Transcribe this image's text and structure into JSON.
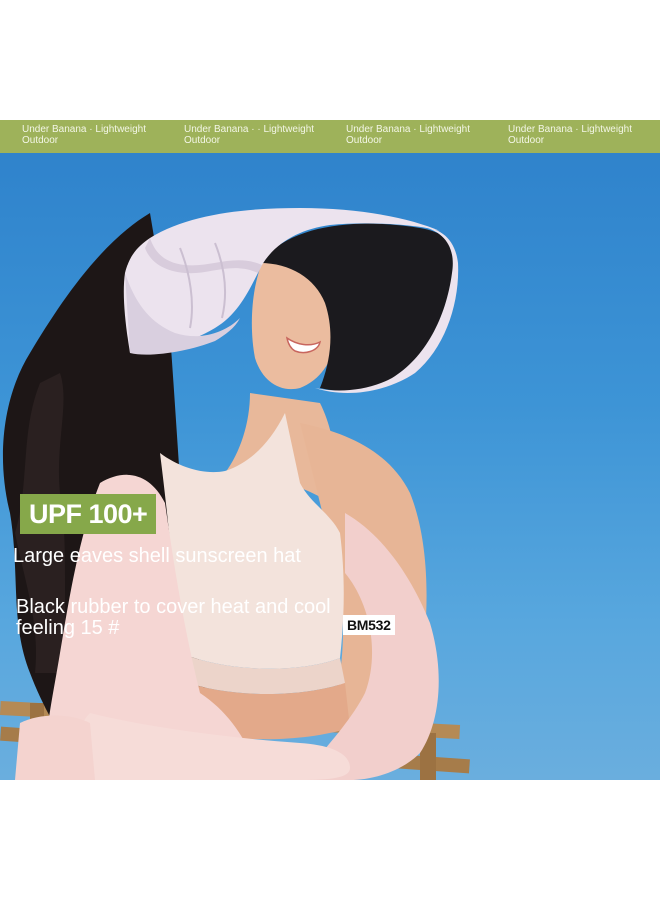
{
  "banner": {
    "items": [
      {
        "line1": "Under Banana · Lightweight",
        "line2": "Outdoor"
      },
      {
        "line1": "Under Banana · · Lightweight",
        "line2": "Outdoor"
      },
      {
        "line1": "Under Banana · Lightweight",
        "line2": "Outdoor"
      },
      {
        "line1": "Under Banana · Lightweight",
        "line2": "Outdoor"
      }
    ]
  },
  "product": {
    "badge": "UPF 100+",
    "title": "Large eaves shell sunscreen hat",
    "subtitle": "Black rubber to cover heat and cool feeling 15 #",
    "model": "BM532"
  },
  "colors": {
    "banner_bg": "#9eb25a",
    "badge_bg": "#86a84a",
    "sky_top": "#2f83cc",
    "sky_bottom": "#6aaede",
    "hat_outer": "#ece3ee",
    "hat_inner": "#1b1a1e"
  }
}
